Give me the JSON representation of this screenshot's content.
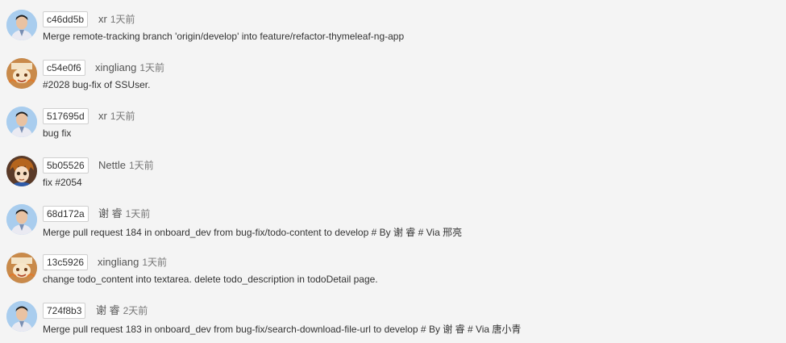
{
  "commits": [
    {
      "sha": "c46dd5b",
      "author": "xr",
      "time": "1天前",
      "message": "Merge remote-tracking branch 'origin/develop' into feature/refactor-thymeleaf-ng-app",
      "avatar_icon": "man-portrait-icon"
    },
    {
      "sha": "c54e0f6",
      "author": "xingliang",
      "time": "1天前",
      "message": "#2028 bug-fix of SSUser.",
      "avatar_icon": "cartoon-character-icon"
    },
    {
      "sha": "517695d",
      "author": "xr",
      "time": "1天前",
      "message": "bug fix",
      "avatar_icon": "man-portrait-icon"
    },
    {
      "sha": "5b05526",
      "author": "Nettle",
      "time": "1天前",
      "message": "fix #2054",
      "avatar_icon": "anime-character-icon"
    },
    {
      "sha": "68d172a",
      "author": "谢 睿",
      "time": "1天前",
      "message": "Merge pull request 184 in onboard_dev from bug-fix/todo-content to develop # By 谢 睿 # Via 邢亮",
      "avatar_icon": "man-portrait-icon"
    },
    {
      "sha": "13c5926",
      "author": "xingliang",
      "time": "1天前",
      "message": "change todo_content into textarea. delete todo_description in todoDetail page.",
      "avatar_icon": "cartoon-character-icon"
    },
    {
      "sha": "724f8b3",
      "author": "谢 睿",
      "time": "2天前",
      "message": "Merge pull request 183 in onboard_dev from bug-fix/search-download-file-url to develop # By 谢 睿 # Via 唐小青",
      "avatar_icon": "man-portrait-icon"
    }
  ]
}
